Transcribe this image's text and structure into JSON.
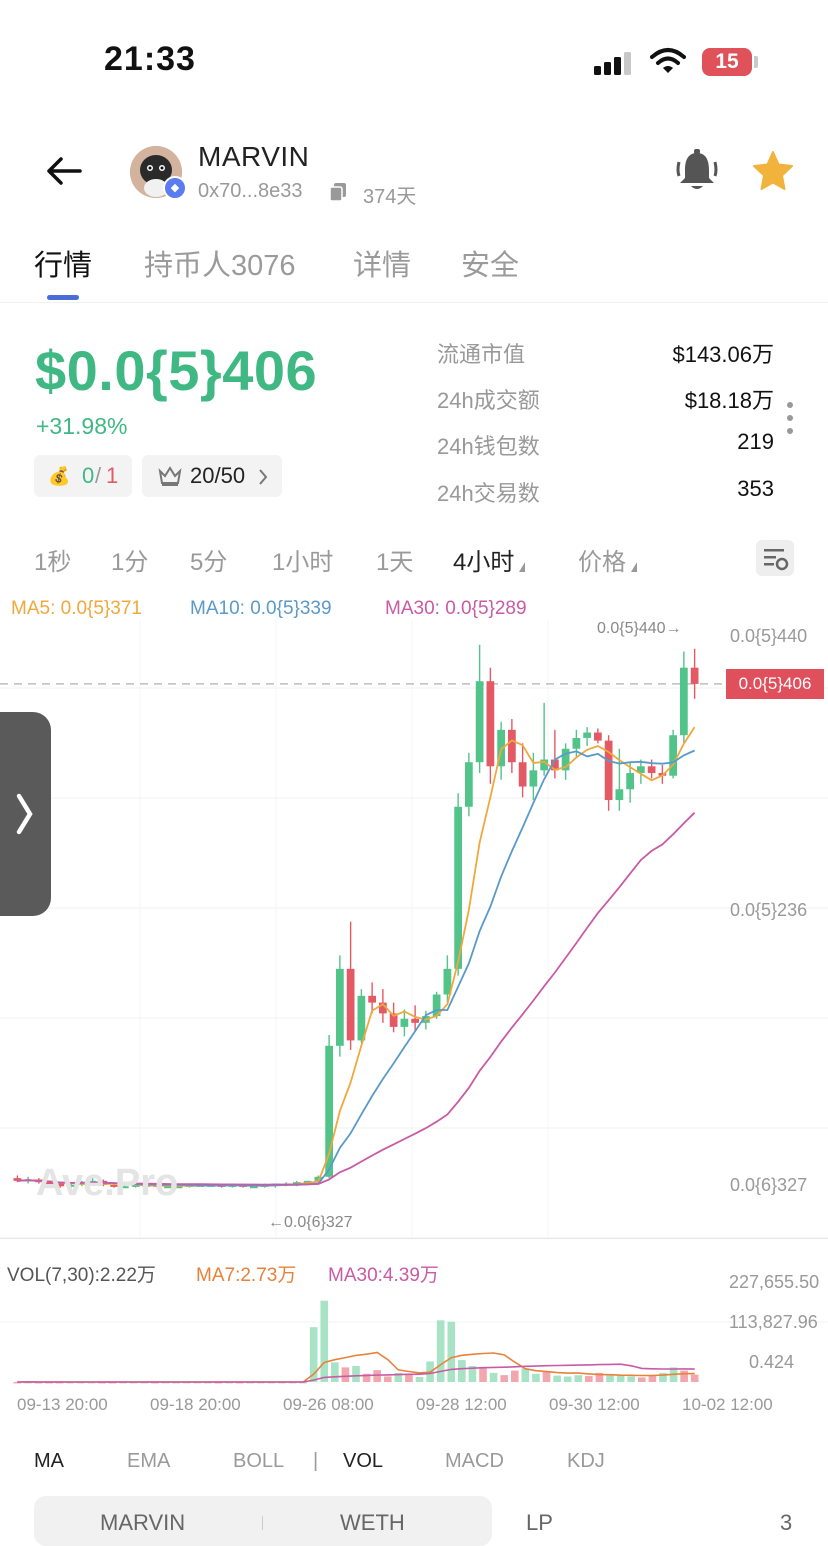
{
  "status_bar": {
    "time": "21:33",
    "battery": "15"
  },
  "header": {
    "token_name": "MARVIN",
    "address": "0x70...8e33",
    "age": "374天",
    "icons": {
      "back": "arrow-left-icon",
      "bell": "bell-icon",
      "star": "star-icon",
      "copy": "copy-icon"
    }
  },
  "tabs": [
    {
      "label": "行情",
      "active": true
    },
    {
      "label": "持币人3076",
      "active": false
    },
    {
      "label": "详情",
      "active": false
    },
    {
      "label": "安全",
      "active": false
    }
  ],
  "price": {
    "value": "$0.0{5}406",
    "change": "+31.98%",
    "color": "#3fb884"
  },
  "badges": {
    "money": {
      "icon": "money-bag-icon",
      "value_a": "0",
      "sep": "/",
      "value_b": "1"
    },
    "top": {
      "icon": "top-crown-icon",
      "value": "20/50"
    }
  },
  "stats": [
    {
      "label": "流通市值",
      "value": "$143.06万"
    },
    {
      "label": "24h成交额",
      "value": "$18.18万"
    },
    {
      "label": "24h钱包数",
      "value": "219"
    },
    {
      "label": "24h交易数",
      "value": "353"
    }
  ],
  "intervals": [
    {
      "label": "1秒",
      "active": false
    },
    {
      "label": "1分",
      "active": false
    },
    {
      "label": "5分",
      "active": false
    },
    {
      "label": "1小时",
      "active": false
    },
    {
      "label": "1天",
      "active": false
    },
    {
      "label": "4小时",
      "active": true,
      "dropdown": true
    },
    {
      "label": "价格",
      "active": false,
      "dropdown": true
    }
  ],
  "ma_legend": [
    {
      "label": "MA5: 0.0{5}371",
      "color": "#f0a83c"
    },
    {
      "label": "MA10: 0.0{5}339",
      "color": "#5a9ac8"
    },
    {
      "label": "MA30: 0.0{5}289",
      "color": "#c95aa6"
    }
  ],
  "chart_axis": {
    "y_labels": [
      "0.0{5}440",
      "0.0{5}236",
      "0.0{6}327"
    ],
    "current_price_tag": "0.0{5}406",
    "high_marker": "0.0{5}440→",
    "low_marker": "←0.0{6}327",
    "watermark": "Ave.Pro"
  },
  "vol_legend": [
    {
      "label": "VOL(7,30):2.22万",
      "color": "#555555"
    },
    {
      "label": "MA7:2.73万",
      "color": "#e8823a"
    },
    {
      "label": "MA30:4.39万",
      "color": "#c95aa6"
    }
  ],
  "vol_axis": [
    "227,655.50",
    "113,827.96",
    "0.424"
  ],
  "time_axis": [
    "09-13 20:00",
    "09-18 20:00",
    "09-26 08:00",
    "09-28 12:00",
    "09-30 12:00",
    "10-02 12:00"
  ],
  "indicator_tabs": [
    {
      "label": "MA",
      "active": true
    },
    {
      "label": "EMA",
      "active": false
    },
    {
      "label": "BOLL",
      "active": false
    },
    {
      "label": "|",
      "active": false
    },
    {
      "label": "VOL",
      "active": true
    },
    {
      "label": "MACD",
      "active": false
    },
    {
      "label": "KDJ",
      "active": false
    }
  ],
  "pair_tabs": {
    "left": "MARVIN",
    "right": "WETH",
    "lp": "LP",
    "lp_count": "3"
  },
  "colors": {
    "up": "#52c48a",
    "down": "#e35a64",
    "accent": "#4b6bd8"
  },
  "chart_data": [
    {
      "type": "candlestick",
      "title": "",
      "x_axis_ticks": [
        "09-13 20:00",
        "09-18 20:00",
        "09-26 08:00",
        "09-28 12:00",
        "09-30 12:00",
        "10-02 12:00"
      ],
      "y_axis_ticks": [
        "0.0{6}327",
        "0.0{5}236",
        "0.0{5}440"
      ],
      "unit_note": "price in units of 1e-6 USD",
      "last_price": 4.06,
      "high": 4.4,
      "low": 0.327,
      "candles_ohlc": [
        [
          0.4,
          0.42,
          0.37,
          0.38
        ],
        [
          0.38,
          0.41,
          0.36,
          0.39
        ],
        [
          0.39,
          0.4,
          0.36,
          0.37
        ],
        [
          0.37,
          0.38,
          0.35,
          0.36
        ],
        [
          0.36,
          0.37,
          0.33,
          0.34
        ],
        [
          0.34,
          0.36,
          0.33,
          0.35
        ],
        [
          0.35,
          0.38,
          0.34,
          0.37
        ],
        [
          0.37,
          0.4,
          0.35,
          0.38
        ],
        [
          0.38,
          0.39,
          0.34,
          0.35
        ],
        [
          0.35,
          0.36,
          0.33,
          0.34
        ],
        [
          0.34,
          0.35,
          0.33,
          0.34
        ],
        [
          0.34,
          0.36,
          0.33,
          0.35
        ],
        [
          0.35,
          0.36,
          0.34,
          0.35
        ],
        [
          0.35,
          0.36,
          0.33,
          0.34
        ],
        [
          0.34,
          0.35,
          0.33,
          0.34
        ],
        [
          0.34,
          0.35,
          0.33,
          0.34
        ],
        [
          0.34,
          0.36,
          0.33,
          0.35
        ],
        [
          0.35,
          0.36,
          0.34,
          0.35
        ],
        [
          0.35,
          0.36,
          0.34,
          0.35
        ],
        [
          0.35,
          0.36,
          0.33,
          0.34
        ],
        [
          0.34,
          0.36,
          0.33,
          0.35
        ],
        [
          0.35,
          0.36,
          0.33,
          0.34
        ],
        [
          0.34,
          0.35,
          0.33,
          0.34
        ],
        [
          0.34,
          0.36,
          0.33,
          0.35
        ],
        [
          0.35,
          0.36,
          0.33,
          0.36
        ],
        [
          0.36,
          0.37,
          0.34,
          0.36
        ],
        [
          0.36,
          0.38,
          0.34,
          0.37
        ],
        [
          0.37,
          0.38,
          0.35,
          0.38
        ],
        [
          0.38,
          0.42,
          0.37,
          0.41
        ],
        [
          0.41,
          1.46,
          0.4,
          1.38
        ],
        [
          1.38,
          2.05,
          1.3,
          1.95
        ],
        [
          1.95,
          2.3,
          1.35,
          1.42
        ],
        [
          1.42,
          1.8,
          1.4,
          1.75
        ],
        [
          1.75,
          1.85,
          1.62,
          1.7
        ],
        [
          1.7,
          1.8,
          1.55,
          1.62
        ],
        [
          1.62,
          1.7,
          1.48,
          1.52
        ],
        [
          1.52,
          1.65,
          1.45,
          1.58
        ],
        [
          1.58,
          1.68,
          1.49,
          1.55
        ],
        [
          1.55,
          1.64,
          1.5,
          1.6
        ],
        [
          1.6,
          1.78,
          1.58,
          1.76
        ],
        [
          1.76,
          2.05,
          1.7,
          1.95
        ],
        [
          1.95,
          3.25,
          1.9,
          3.15
        ],
        [
          3.15,
          3.55,
          3.08,
          3.48
        ],
        [
          3.48,
          4.35,
          3.4,
          4.08
        ],
        [
          4.08,
          4.18,
          3.32,
          3.45
        ],
        [
          3.45,
          3.78,
          3.35,
          3.72
        ],
        [
          3.72,
          3.8,
          3.4,
          3.48
        ],
        [
          3.48,
          3.62,
          3.22,
          3.3
        ],
        [
          3.3,
          3.55,
          3.2,
          3.42
        ],
        [
          3.42,
          3.92,
          3.38,
          3.5
        ],
        [
          3.5,
          3.72,
          3.36,
          3.42
        ],
        [
          3.42,
          3.62,
          3.35,
          3.58
        ],
        [
          3.58,
          3.72,
          3.52,
          3.66
        ],
        [
          3.66,
          3.74,
          3.6,
          3.7
        ],
        [
          3.7,
          3.73,
          3.62,
          3.64
        ],
        [
          3.64,
          3.68,
          3.12,
          3.2
        ],
        [
          3.2,
          3.58,
          3.12,
          3.28
        ],
        [
          3.28,
          3.48,
          3.18,
          3.4
        ],
        [
          3.4,
          3.5,
          3.32,
          3.45
        ],
        [
          3.45,
          3.5,
          3.36,
          3.4
        ],
        [
          3.4,
          3.46,
          3.32,
          3.38
        ],
        [
          3.38,
          3.72,
          3.36,
          3.68
        ],
        [
          3.68,
          4.3,
          3.62,
          4.18
        ],
        [
          4.18,
          4.32,
          3.95,
          4.06
        ]
      ],
      "series": [
        {
          "name": "MA5",
          "last": 3.71,
          "color": "#f0a83c"
        },
        {
          "name": "MA10",
          "last": 3.39,
          "color": "#5a9ac8"
        },
        {
          "name": "MA30",
          "last": 2.89,
          "color": "#c95aa6"
        }
      ]
    },
    {
      "type": "bar",
      "title": "VOL(7,30):2.22万",
      "y_axis_ticks": [
        "0.424",
        "113,827.96",
        "227,655.50"
      ],
      "ylim": [
        0,
        227655.5
      ],
      "values": [
        100,
        120,
        80,
        90,
        110,
        90,
        100,
        95,
        105,
        85,
        90,
        80,
        100,
        90,
        95,
        85,
        90,
        80,
        95,
        90,
        85,
        100,
        90,
        95,
        80,
        90,
        100,
        95,
        120000,
        178000,
        43000,
        32000,
        35000,
        18000,
        26000,
        12000,
        20000,
        18000,
        11000,
        45000,
        135000,
        132000,
        48000,
        35000,
        30000,
        20000,
        15000,
        25000,
        30000,
        18000,
        22000,
        14000,
        12000,
        15000,
        13000,
        20000,
        16000,
        14000,
        12000,
        10000,
        14000,
        20000,
        32000,
        25000,
        16000
      ],
      "series": [
        {
          "name": "MA7",
          "last": 27300,
          "color": "#e8823a"
        },
        {
          "name": "MA30",
          "last": 43900,
          "color": "#c95aa6"
        }
      ]
    }
  ]
}
